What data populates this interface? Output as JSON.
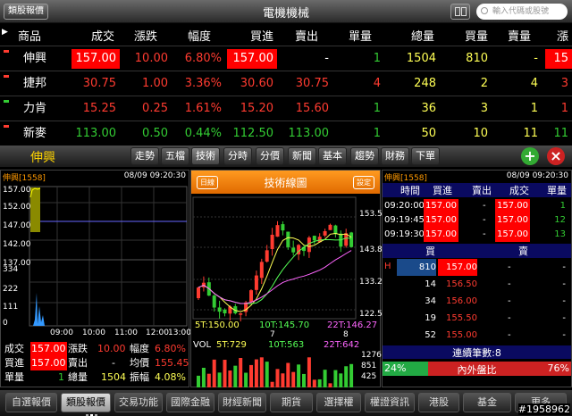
{
  "topbar": {
    "back": "類股報價",
    "title": "電機機械",
    "search_placeholder": "輸入代碼或股號"
  },
  "quote_header": [
    "商品",
    "成交",
    "漲跌",
    "幅度",
    "買進",
    "賣出",
    "單量",
    "總量",
    "買量",
    "賣量",
    "漲"
  ],
  "quote_rows": [
    {
      "name": "伸興",
      "price": "157.00",
      "chg": "10.00",
      "pct": "6.80%",
      "bid": "157.00",
      "ask": "-",
      "vol": "1",
      "total": "1504",
      "bidvol": "810",
      "askvol": "-",
      "last": "15"
    },
    {
      "name": "捷邦",
      "price": "30.75",
      "chg": "1.00",
      "pct": "3.36%",
      "bid": "30.60",
      "ask": "30.75",
      "vol": "4",
      "total": "248",
      "bidvol": "2",
      "askvol": "4",
      "last": "3"
    },
    {
      "name": "力肯",
      "price": "15.25",
      "chg": "0.25",
      "pct": "1.61%",
      "bid": "15.20",
      "ask": "15.60",
      "vol": "1",
      "total": "36",
      "bidvol": "3",
      "askvol": "1",
      "last": "1"
    },
    {
      "name": "新麥",
      "price": "113.00",
      "chg": "0.50",
      "pct": "0.44%",
      "bid": "112.50",
      "ask": "113.00",
      "vol": "1",
      "total": "50",
      "bidvol": "10",
      "askvol": "11",
      "last": "11"
    }
  ],
  "toolbar": {
    "stock": "伸興",
    "tabs": [
      "走勢",
      "五檔",
      "技術",
      "分時",
      "分價",
      "新聞",
      "基本",
      "趨勢",
      "財務",
      "下單"
    ],
    "plus": "+",
    "close": "×"
  },
  "intraday": {
    "title": "伸興[1558]",
    "time": "08/09 09:20:30",
    "y": [
      "157.00",
      "152.00",
      "147.00",
      "142.00",
      "137.00"
    ],
    "vy": [
      "334",
      "222",
      "111",
      "0"
    ],
    "x": [
      "09:00",
      "10:00",
      "11:00",
      "12:00",
      "13:00"
    ],
    "r1": {
      "a": "成交",
      "av": "157.00",
      "b": "漲跌",
      "bv": "10.00",
      "c": "幅度",
      "cv": "6.80%"
    },
    "r2": {
      "a": "買進",
      "av": "157.00",
      "b": "賣出",
      "bv": "-",
      "c": "均價",
      "cv": "155.45"
    },
    "r3": {
      "a": "單量",
      "av": "1",
      "b": "總量",
      "bv": "1504",
      "c": "振幅",
      "cv": "4.08%"
    }
  },
  "tech": {
    "btn_left": "日線",
    "title": "技術線圖",
    "btn_right": "設定",
    "y": [
      "153.5",
      "143.8",
      "133.2",
      "122.5"
    ],
    "ma5": "5T:150.00",
    "ma10": "10T:145.70",
    "ma22": "22T:146.27",
    "vol": "VOL",
    "v5": "5T:729",
    "v10": "10T:563",
    "v22": "22T:642",
    "vy": [
      "1276",
      "851",
      "425"
    ],
    "x1": "7",
    "x2": "8"
  },
  "ticks": {
    "title": "伸興[1558]",
    "time": "08/09 09:20:30",
    "head": [
      "時間",
      "買進",
      "賣出",
      "成交",
      "單量"
    ],
    "rows": [
      {
        "t": "09:20:00",
        "b": "157.00",
        "s": "-",
        "p": "157.00",
        "v": "1"
      },
      {
        "t": "09:19:45",
        "b": "157.00",
        "s": "-",
        "p": "157.00",
        "v": "12"
      },
      {
        "t": "09:19:30",
        "b": "157.00",
        "s": "-",
        "p": "157.00",
        "v": "13"
      }
    ],
    "buy": "買",
    "sell": "賣",
    "book": [
      {
        "bv": "810",
        "bp": "157.00",
        "sp": "-",
        "sv": "-"
      },
      {
        "bv": "14",
        "bp": "156.50",
        "sp": "-",
        "sv": "-"
      },
      {
        "bv": "34",
        "bp": "156.00",
        "sp": "-",
        "sv": "-"
      },
      {
        "bv": "19",
        "bp": "155.50",
        "sp": "-",
        "sv": "-"
      },
      {
        "bv": "52",
        "bp": "155.00",
        "sp": "-",
        "sv": "-"
      }
    ],
    "h": "H",
    "count": "連續筆數:8",
    "inner": "24%",
    "outer_label": "內外盤比",
    "outer": "76%"
  },
  "nav": [
    "自選報價",
    "類股報價",
    "交易功能",
    "國際金融",
    "財經新聞",
    "期貨",
    "選擇權",
    "權證資訊",
    "港股",
    "基金",
    "更多"
  ],
  "watermark": "#1958962"
}
